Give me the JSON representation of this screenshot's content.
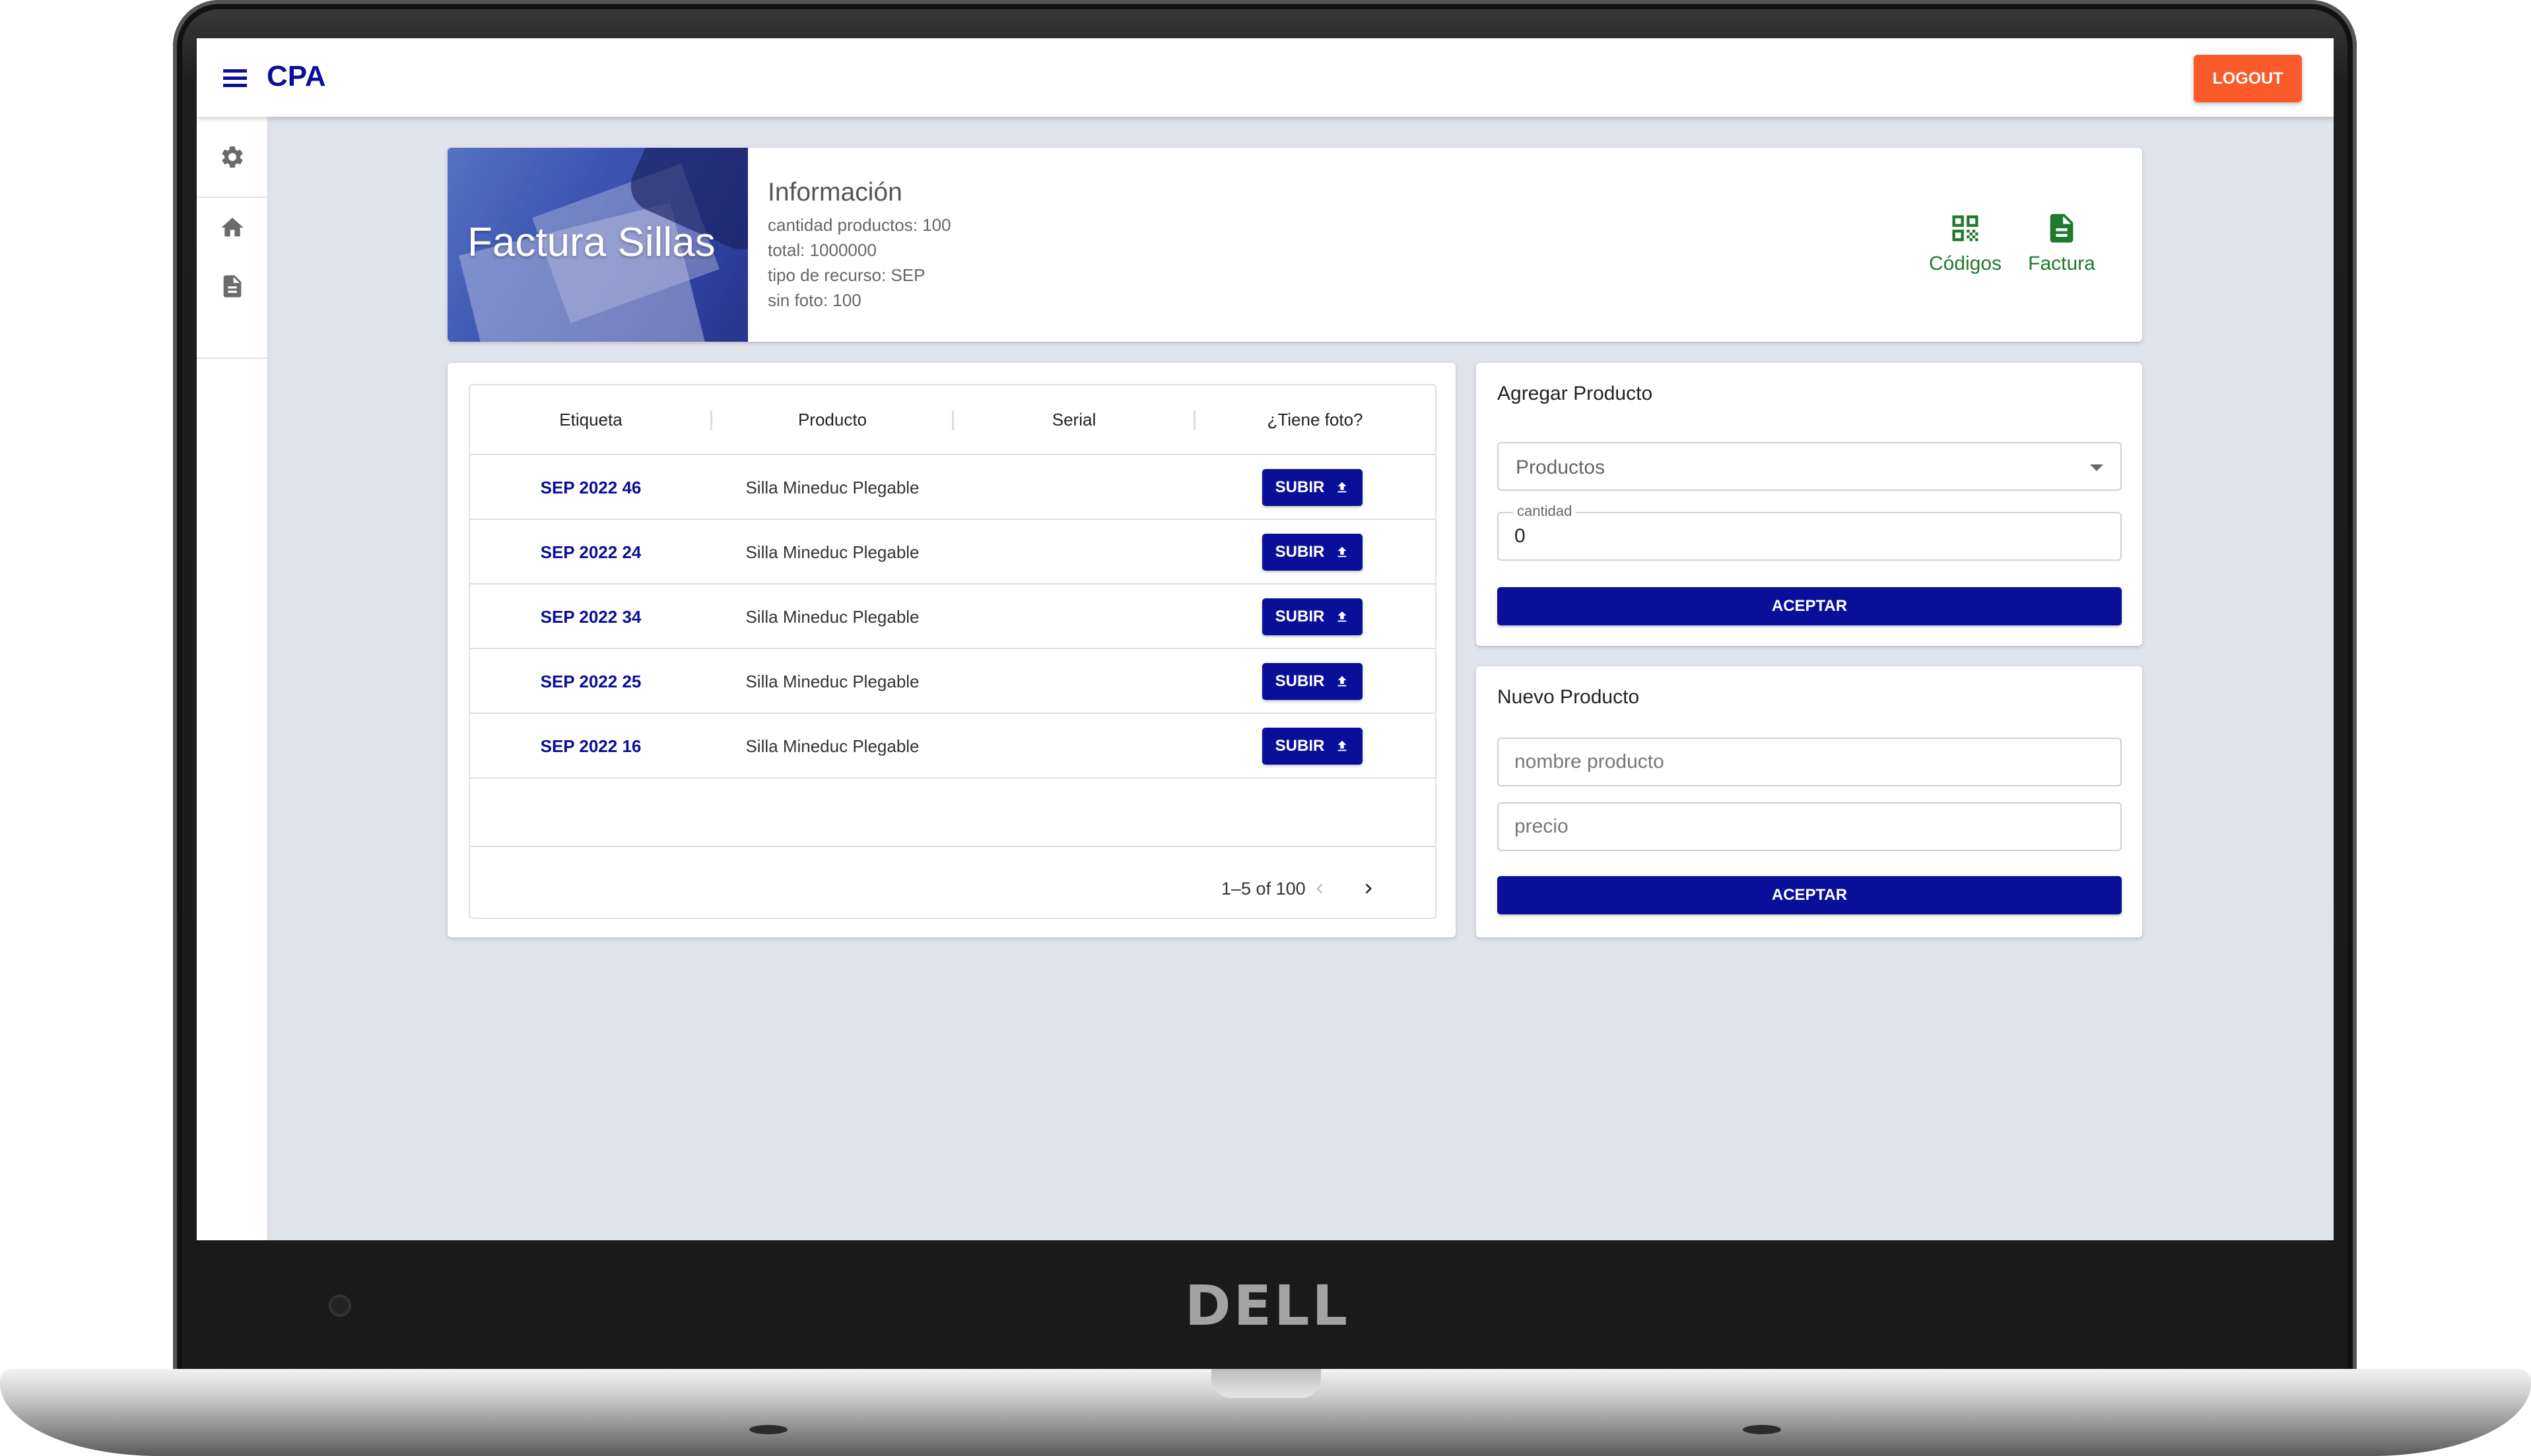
{
  "device": {
    "brand": "DELL"
  },
  "header": {
    "app_title": "CPA",
    "logout_label": "LOGOUT"
  },
  "sidebar": {
    "items": [
      {
        "icon": "gear-icon"
      },
      {
        "icon": "home-icon"
      },
      {
        "icon": "document-icon"
      }
    ]
  },
  "info": {
    "banner_title": "Factura Sillas",
    "heading": "Información",
    "lines": [
      "cantidad productos: 100",
      "total: 1000000",
      "tipo de recurso: SEP",
      "sin foto: 100"
    ],
    "actions": [
      {
        "icon": "qr-code-icon",
        "label": "Códigos"
      },
      {
        "icon": "document-icon",
        "label": "Factura"
      }
    ],
    "accent_color": "#1f7a2b"
  },
  "table": {
    "columns": [
      "Etiqueta",
      "Producto",
      "Serial",
      "¿Tiene foto?"
    ],
    "rows": [
      {
        "tag": "SEP 2022 46",
        "product": "Silla Mineduc Plegable",
        "serial": "",
        "action": "SUBIR"
      },
      {
        "tag": "SEP 2022 24",
        "product": "Silla Mineduc Plegable",
        "serial": "",
        "action": "SUBIR"
      },
      {
        "tag": "SEP 2022 34",
        "product": "Silla Mineduc Plegable",
        "serial": "",
        "action": "SUBIR"
      },
      {
        "tag": "SEP 2022 25",
        "product": "Silla Mineduc Plegable",
        "serial": "",
        "action": "SUBIR"
      },
      {
        "tag": "SEP 2022 16",
        "product": "Silla Mineduc Plegable",
        "serial": "",
        "action": "SUBIR"
      }
    ],
    "pagination": "1–5 of 100"
  },
  "add_product": {
    "title": "Agregar Producto",
    "select_value": "Productos",
    "quantity_label": "cantidad",
    "quantity_value": "0",
    "accept_label": "ACEPTAR"
  },
  "new_product": {
    "title": "Nuevo Producto",
    "name_placeholder": "nombre producto",
    "price_placeholder": "precio",
    "accept_label": "ACEPTAR"
  },
  "colors": {
    "primary": "#0a0f9a",
    "logout": "#fb5a2a",
    "success": "#1f7a2b",
    "background": "#dfe3ea"
  }
}
